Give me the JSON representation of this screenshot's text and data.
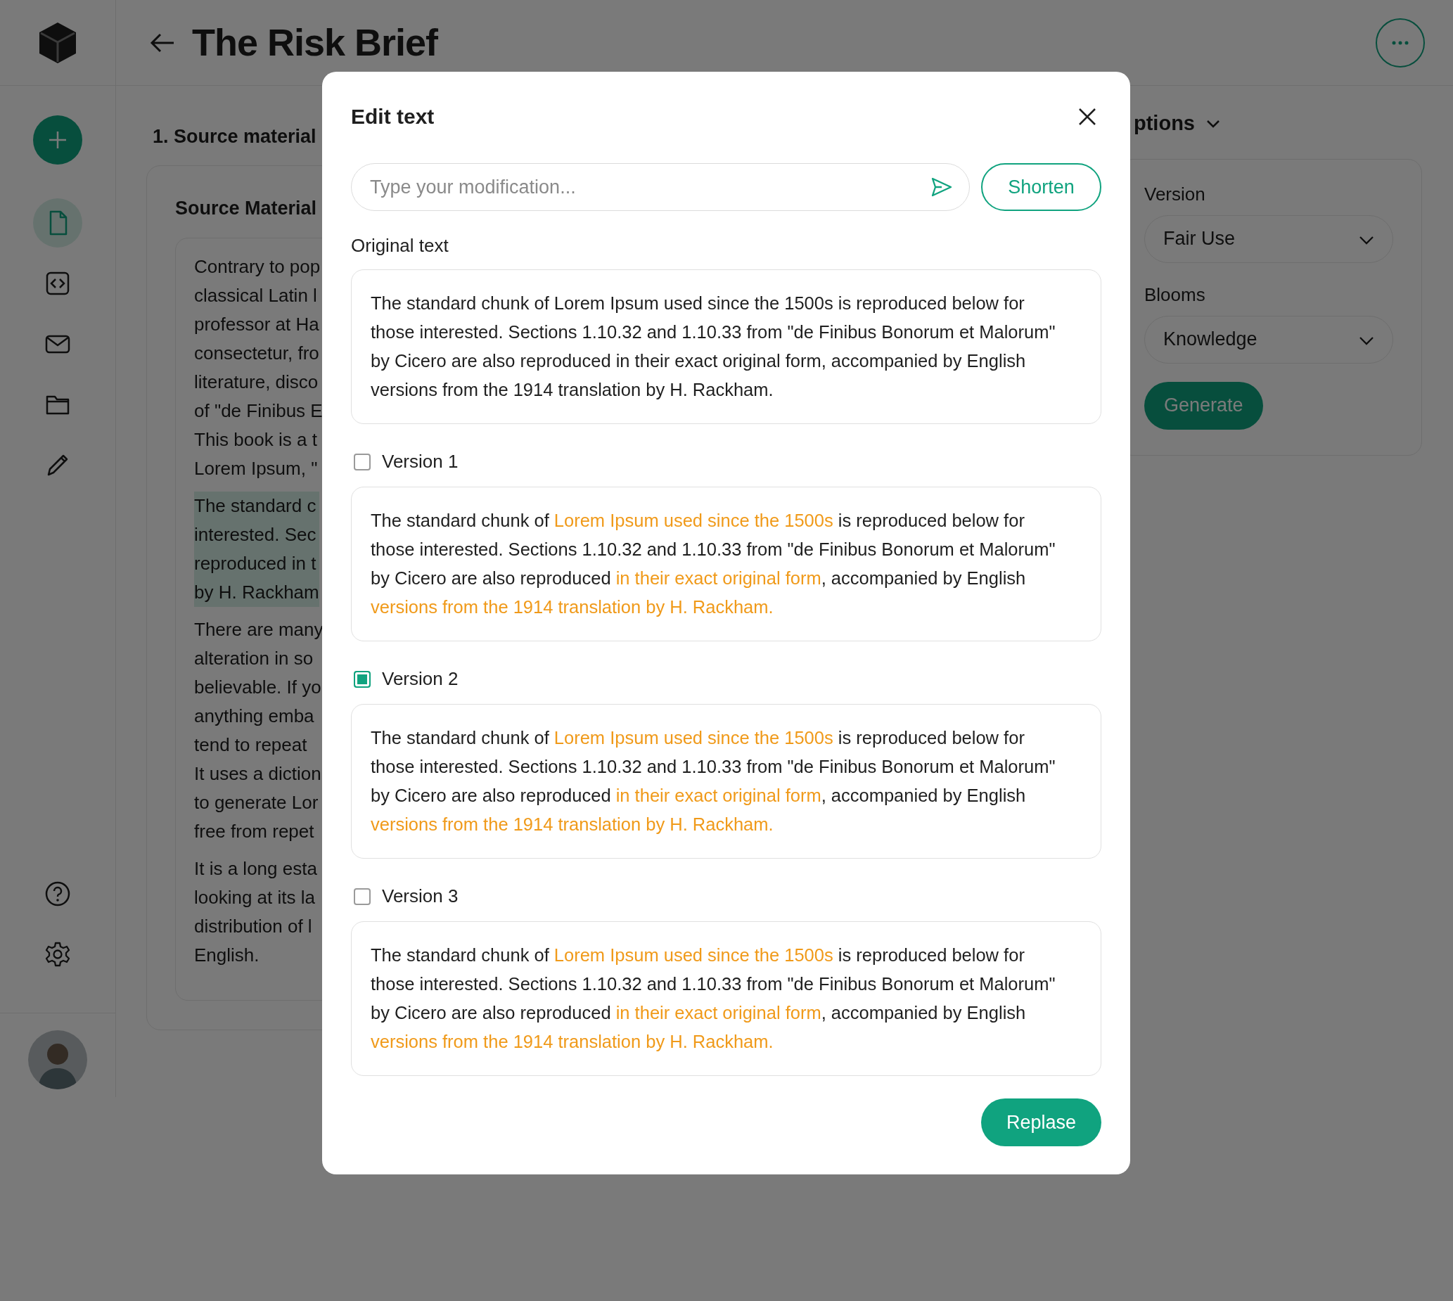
{
  "app": {
    "title": "The Risk Brief"
  },
  "sidebar": {
    "items": [
      {
        "kind": "file",
        "selected": true
      },
      {
        "kind": "code",
        "selected": false
      },
      {
        "kind": "mail",
        "selected": false
      },
      {
        "kind": "folder",
        "selected": false
      },
      {
        "kind": "pencil",
        "selected": false
      }
    ]
  },
  "source": {
    "step": "1. Source material",
    "heading": "Source Material",
    "paragraphs": [
      {
        "highlighted": false,
        "lines": [
          "Contrary to pop",
          "classical Latin l",
          "professor at Ha",
          "consectetur, fro",
          "literature, disco",
          "of \"de Finibus E",
          "This book is a t",
          "Lorem Ipsum, \""
        ]
      },
      {
        "highlighted": true,
        "lines": [
          "The standard c",
          "interested. Sec",
          "reproduced in t",
          "by H. Rackham"
        ]
      },
      {
        "highlighted": false,
        "lines": [
          "There are many",
          "alteration in so",
          "believable. If yo",
          "anything emba",
          "tend to repeat",
          "It uses a diction",
          "to generate Lor",
          "free from repet"
        ]
      },
      {
        "highlighted": false,
        "lines": [
          "It is a long esta",
          "looking at its la",
          "distribution of l",
          "English."
        ]
      }
    ]
  },
  "options": {
    "heading": "ptions",
    "fields": [
      {
        "label": "Version",
        "value": "Fair Use"
      },
      {
        "label": "Blooms",
        "value": "Knowledge"
      }
    ],
    "button": "Generate"
  },
  "dialog": {
    "title": "Edit text",
    "input": {
      "placeholder": "Type your modification..."
    },
    "shorten": "Shorten",
    "original_label": "Original text",
    "original_text": "The standard chunk of Lorem Ipsum used since the 1500s is reproduced below for those interested. Sections 1.10.32 and 1.10.33 from \"de Finibus Bonorum et Malorum\" by Cicero are also reproduced in their exact original form, accompanied by English versions from the 1914 translation by H. Rackham.",
    "versions": [
      {
        "label": "Version 1",
        "checked": false,
        "parts": [
          {
            "text": "The standard chunk of ",
            "highlight": false
          },
          {
            "text": "Lorem Ipsum used since the 1500s",
            "highlight": true
          },
          {
            "text": " is reproduced below for those interested. Sections 1.10.32 and 1.10.33 from \"de Finibus Bonorum et Malorum\" by Cicero are also reproduced ",
            "highlight": false
          },
          {
            "text": "in their exact original form",
            "highlight": true
          },
          {
            "text": ", accompanied by English ",
            "highlight": false
          },
          {
            "text": "versions from the 1914 translation by H. Rackham.",
            "highlight": true
          }
        ]
      },
      {
        "label": "Version 2",
        "checked": true,
        "parts": [
          {
            "text": "The standard chunk of ",
            "highlight": false
          },
          {
            "text": "Lorem Ipsum used since the 1500s",
            "highlight": true
          },
          {
            "text": " is reproduced below for those interested. Sections 1.10.32 and 1.10.33 from \"de Finibus Bonorum et Malorum\" by Cicero are also reproduced ",
            "highlight": false
          },
          {
            "text": "in their exact original form",
            "highlight": true
          },
          {
            "text": ", accompanied by English ",
            "highlight": false
          },
          {
            "text": "versions from the 1914 translation by H. Rackham.",
            "highlight": true
          }
        ]
      },
      {
        "label": "Version 3",
        "checked": false,
        "parts": [
          {
            "text": "The standard chunk of ",
            "highlight": false
          },
          {
            "text": "Lorem Ipsum used since the 1500s",
            "highlight": true
          },
          {
            "text": " is reproduced below for those interested. Sections 1.10.32 and 1.10.33 from \"de Finibus Bonorum et Malorum\" by Cicero are also reproduced ",
            "highlight": false
          },
          {
            "text": "in their exact original form",
            "highlight": true
          },
          {
            "text": ", accompanied by English ",
            "highlight": false
          },
          {
            "text": "versions from the 1914 translation by H. Rackham.",
            "highlight": true
          }
        ]
      }
    ],
    "replace": "Replase"
  }
}
